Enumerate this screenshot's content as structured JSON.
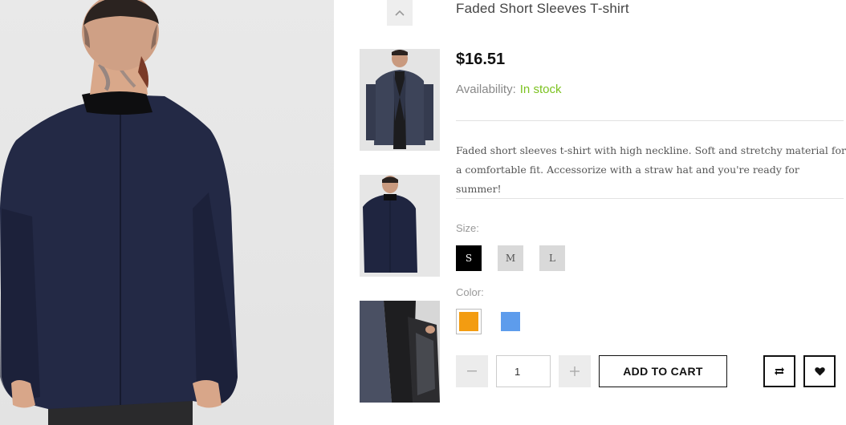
{
  "product": {
    "title": "Faded Short Sleeves T-shirt",
    "price": "$16.51",
    "availability_label": "Availability:",
    "availability_value": "In stock",
    "description": "Faded short sleeves t-shirt with high neckline. Soft and stretchy material for a comfortable fit. Accessorize with a straw hat and you're ready for summer!"
  },
  "gallery": {
    "main_image": "man-blazer-back-view",
    "thumbnails": [
      {
        "name": "blazer-front-view"
      },
      {
        "name": "blazer-back-view"
      },
      {
        "name": "blazer-lining-detail"
      }
    ],
    "scroll_up_icon": "chevron-up-icon"
  },
  "size": {
    "label": "Size:",
    "options": [
      "S",
      "M",
      "L"
    ],
    "selected": "S"
  },
  "color": {
    "label": "Color:",
    "options": [
      {
        "name": "orange",
        "hex": "#F39C11"
      },
      {
        "name": "blue",
        "hex": "#5D9CEC"
      }
    ],
    "selected": "orange"
  },
  "cart": {
    "minus_icon": "minus-icon",
    "quantity": "1",
    "plus_icon": "plus-icon",
    "add_label": "ADD TO CART",
    "compare_icon": "compare-icon",
    "wishlist_icon": "heart-icon"
  },
  "colors": {
    "in_stock": "#7CC220",
    "active_size": "#000000",
    "inactive_size": "#D9D9D9"
  }
}
